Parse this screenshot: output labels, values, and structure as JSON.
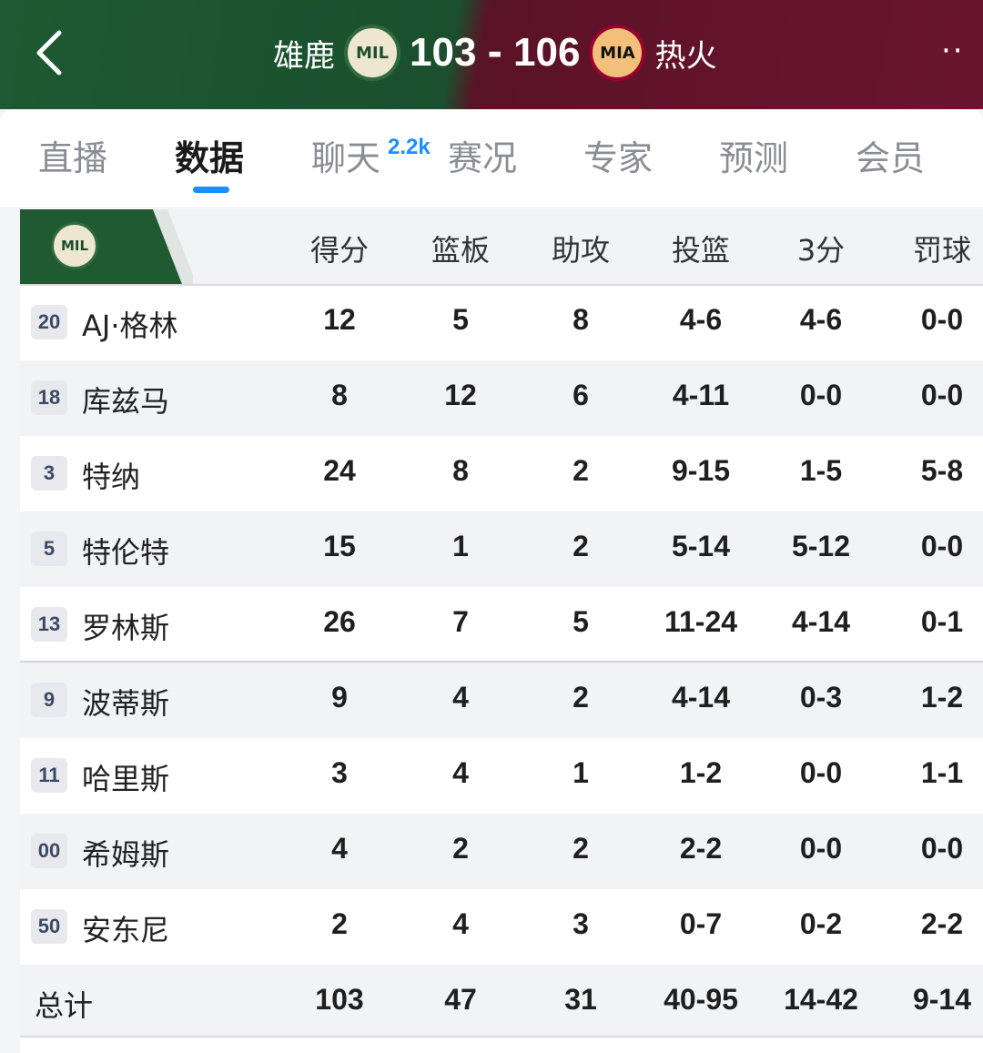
{
  "header": {
    "home_team": "雄鹿",
    "home_logo_text": "MIL",
    "home_score": "103",
    "separator": "-",
    "away_score": "106",
    "away_logo_text": "MIA",
    "away_team": "热火",
    "more_label": "··",
    "colors": {
      "home": "#1b4f2d",
      "away": "#6a1530"
    }
  },
  "tabs": [
    {
      "label": "直播"
    },
    {
      "label": "数据"
    },
    {
      "label": "聊天",
      "badge": "2.2k"
    },
    {
      "label": "赛况"
    },
    {
      "label": "专家"
    },
    {
      "label": "预测"
    },
    {
      "label": "会员"
    }
  ],
  "active_tab": "数据",
  "table": {
    "team_logo_text": "MIL",
    "columns": [
      "得分",
      "篮板",
      "助攻",
      "投篮",
      "3分",
      "罚球"
    ],
    "rows": [
      {
        "number": "20",
        "name": "AJ·格林",
        "stats": [
          "12",
          "5",
          "8",
          "4-6",
          "4-6",
          "0-0"
        ]
      },
      {
        "number": "18",
        "name": "库兹马",
        "stats": [
          "8",
          "12",
          "6",
          "4-11",
          "0-0",
          "0-0"
        ]
      },
      {
        "number": "3",
        "name": "特纳",
        "stats": [
          "24",
          "8",
          "2",
          "9-15",
          "1-5",
          "5-8"
        ]
      },
      {
        "number": "5",
        "name": "特伦特",
        "stats": [
          "15",
          "1",
          "2",
          "5-14",
          "5-12",
          "0-0"
        ]
      },
      {
        "number": "13",
        "name": "罗林斯",
        "stats": [
          "26",
          "7",
          "5",
          "11-24",
          "4-14",
          "0-1"
        ]
      },
      {
        "number": "9",
        "name": "波蒂斯",
        "stats": [
          "9",
          "4",
          "2",
          "4-14",
          "0-3",
          "1-2"
        ]
      },
      {
        "number": "11",
        "name": "哈里斯",
        "stats": [
          "3",
          "4",
          "1",
          "1-2",
          "0-0",
          "1-1"
        ]
      },
      {
        "number": "00",
        "name": "希姆斯",
        "stats": [
          "4",
          "2",
          "2",
          "2-2",
          "0-0",
          "0-0"
        ]
      },
      {
        "number": "50",
        "name": "安东尼",
        "stats": [
          "2",
          "4",
          "3",
          "0-7",
          "0-2",
          "2-2"
        ]
      }
    ],
    "totals": {
      "label": "总计",
      "stats": [
        "103",
        "47",
        "31",
        "40-95",
        "14-42",
        "9-14"
      ]
    }
  }
}
